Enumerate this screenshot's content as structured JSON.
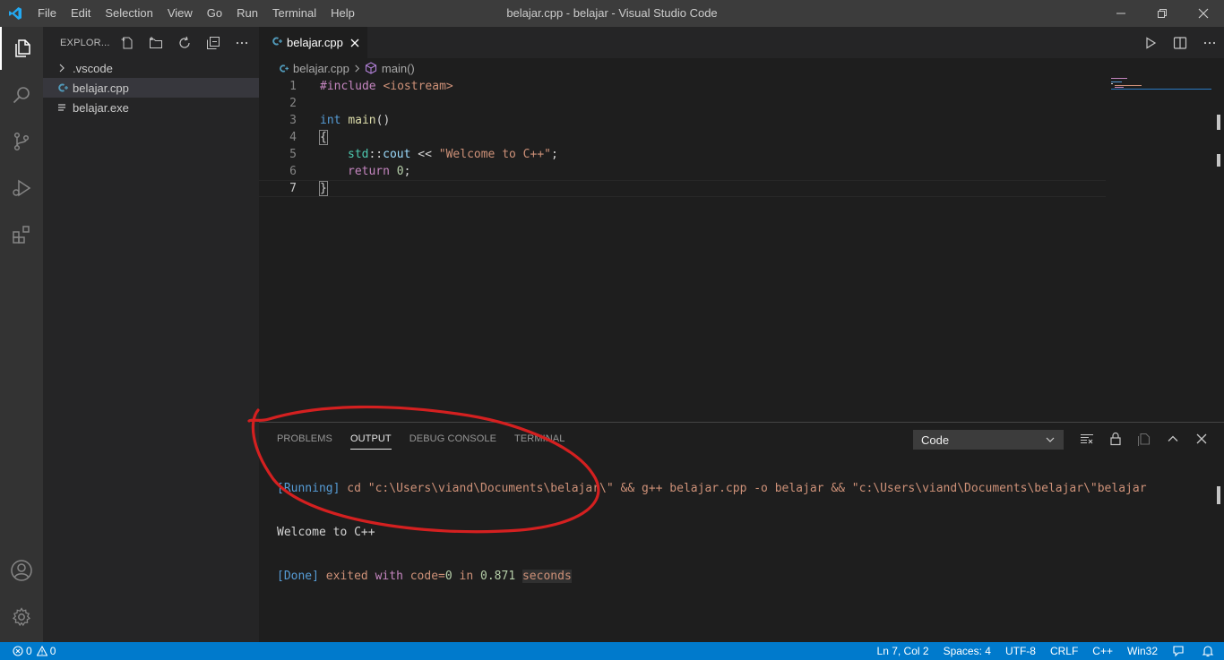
{
  "window": {
    "menu": [
      "File",
      "Edit",
      "Selection",
      "View",
      "Go",
      "Run",
      "Terminal",
      "Help"
    ],
    "title": "belajar.cpp - belajar - Visual Studio Code"
  },
  "sidebar": {
    "title": "EXPLOR...",
    "items": [
      {
        "label": ".vscode",
        "kind": "folder"
      },
      {
        "label": "belajar.cpp",
        "kind": "cpp-file"
      },
      {
        "label": "belajar.exe",
        "kind": "file"
      }
    ]
  },
  "editor": {
    "tab_label": "belajar.cpp",
    "breadcrumb": {
      "file": "belajar.cpp",
      "symbol": "main()"
    },
    "line_numbers": [
      "1",
      "2",
      "3",
      "4",
      "5",
      "6",
      "7"
    ],
    "code": {
      "l1_directive": "#include",
      "l1_header": "<iostream>",
      "l3_type": "int",
      "l3_name": "main",
      "l3_parens": "()",
      "l4_brace": "{",
      "l5_ns": "std",
      "l5_scope": "::",
      "l5_obj": "cout",
      "l5_op": " << ",
      "l5_str": "\"Welcome to C++\"",
      "l5_semi": ";",
      "l6_kw": "return",
      "l6_num": "0",
      "l6_semi": ";",
      "l7_brace": "}"
    }
  },
  "panel": {
    "tabs": [
      "PROBLEMS",
      "OUTPUT",
      "DEBUG CONSOLE",
      "TERMINAL"
    ],
    "active_tab": "OUTPUT",
    "channel": "Code",
    "output": {
      "running_tag": "[Running]",
      "running_cmd": " cd \"c:\\Users\\viand\\Documents\\belajar\\\" && g++ belajar.cpp -o belajar && \"c:\\Users\\viand\\Documents\\belajar\\\"belajar",
      "program_output": "Welcome to C++",
      "done_tag": "[Done]",
      "done_text1": " exited ",
      "done_with": "with",
      "done_text2": " code=",
      "done_code": "0",
      "done_in": " in ",
      "done_time": "0.871",
      "done_seconds": "seconds"
    }
  },
  "statusbar": {
    "errors": "0",
    "warnings": "0",
    "position": "Ln 7, Col 2",
    "spaces": "Spaces: 4",
    "encoding": "UTF-8",
    "eol": "CRLF",
    "language": "C++",
    "platform": "Win32"
  },
  "colors": {
    "accent": "#007acc",
    "annotation": "#d42020"
  },
  "icons": [
    "vscode-logo-icon",
    "files-icon",
    "search-icon",
    "source-control-icon",
    "run-debug-icon",
    "extensions-icon",
    "account-icon",
    "manage-gear-icon"
  ]
}
